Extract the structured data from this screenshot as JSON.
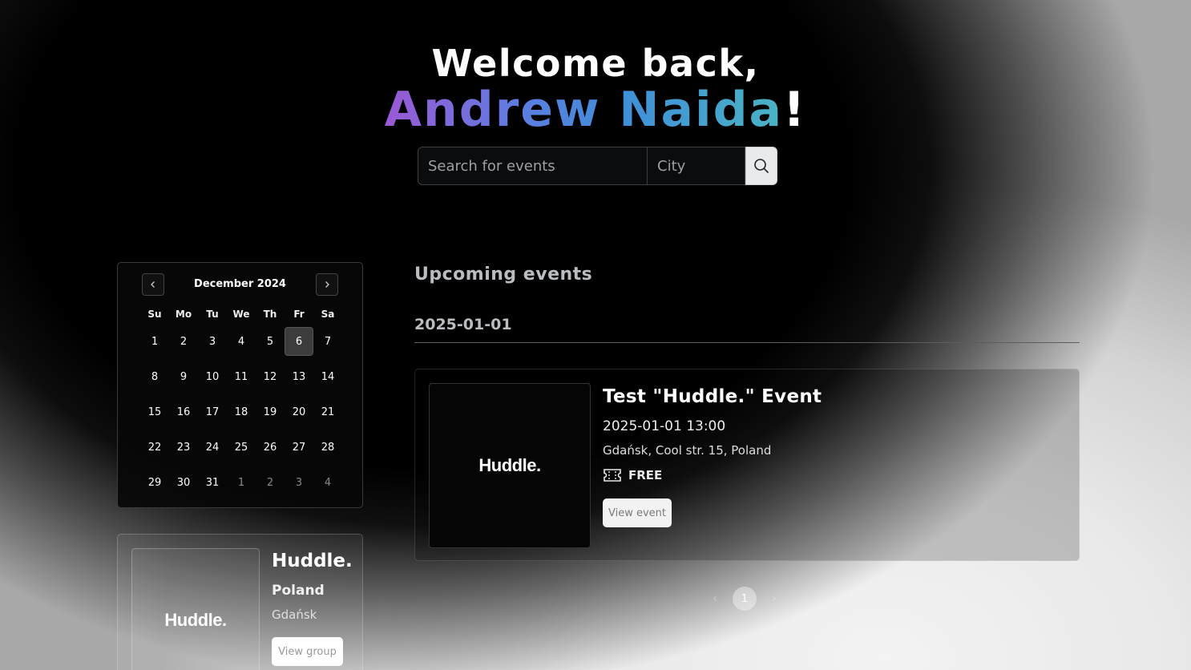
{
  "hero": {
    "greeting": "Welcome back,",
    "user_name": "Andrew Naida",
    "exclaim": "!"
  },
  "search": {
    "events_placeholder": "Search for events",
    "city_placeholder": "City",
    "button_icon": "search-icon"
  },
  "calendar": {
    "month_label": "December 2024",
    "weekdays": [
      "Su",
      "Mo",
      "Tu",
      "We",
      "Th",
      "Fr",
      "Sa"
    ],
    "weeks": [
      [
        "1",
        "2",
        "3",
        "4",
        "5",
        "6",
        "7"
      ],
      [
        "8",
        "9",
        "10",
        "11",
        "12",
        "13",
        "14"
      ],
      [
        "15",
        "16",
        "17",
        "18",
        "19",
        "20",
        "21"
      ],
      [
        "22",
        "23",
        "24",
        "25",
        "26",
        "27",
        "28"
      ],
      [
        "29",
        "30",
        "31",
        "1",
        "2",
        "3",
        "4"
      ]
    ],
    "selected_day": "6",
    "prev_icon": "chevron-left-icon",
    "next_icon": "chevron-right-icon"
  },
  "group": {
    "logo_text": "Huddle.",
    "name": "Huddle.",
    "country": "Poland",
    "city": "Gdańsk",
    "button_label": "View group"
  },
  "upcoming": {
    "title": "Upcoming events",
    "date_heading": "2025-01-01",
    "events": [
      {
        "logo_text": "Huddle.",
        "title": "Test \"Huddle.\" Event",
        "datetime": "2025-01-01 13:00",
        "location": "Gdańsk, Cool str. 15, Poland",
        "price": "FREE",
        "price_icon": "ticket-icon",
        "button_label": "View event"
      }
    ]
  },
  "pagination": {
    "prev": "‹",
    "current_page": "1",
    "next": "›"
  }
}
